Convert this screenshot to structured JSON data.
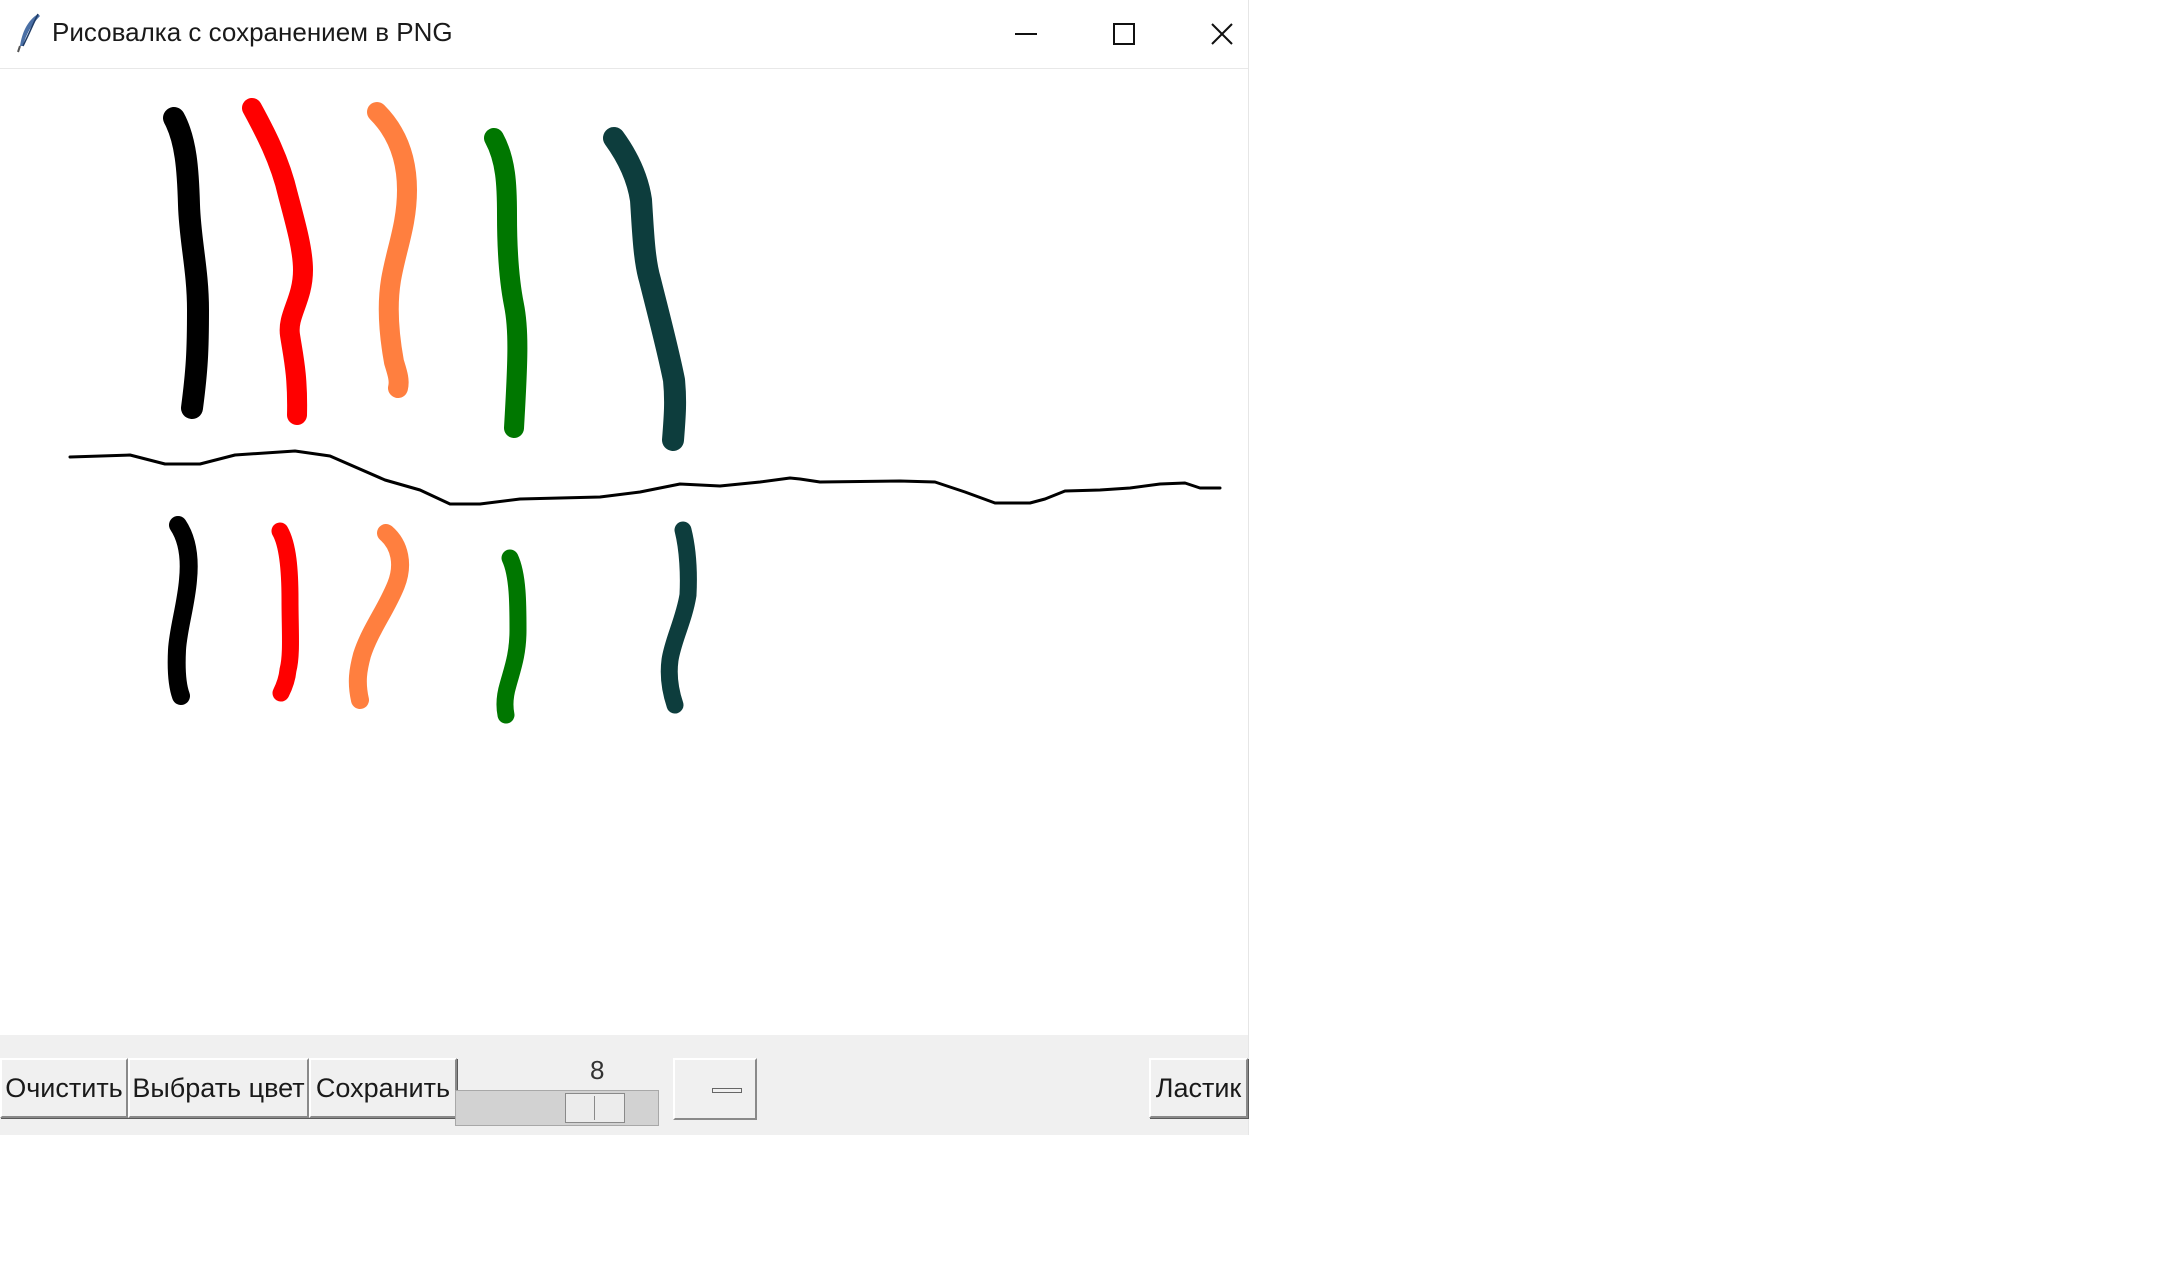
{
  "window": {
    "title": "Рисовалка с сохранением в PNG",
    "icon": "feather-icon",
    "controls": [
      "minimize-icon",
      "maximize-icon",
      "close-icon"
    ]
  },
  "canvas": {
    "background": "#ffffff",
    "stroke_colors": [
      "#000000",
      "#ff0000",
      "#ff7f3f",
      "#007700",
      "#0d3d3d"
    ]
  },
  "toolbar": {
    "clear_label": "Очистить",
    "choose_color_label": "Выбрать цвет",
    "save_label": "Сохранить",
    "brush_size_value": "8",
    "brush_size": 8,
    "brush_size_range": [
      1,
      10
    ],
    "eraser_label": "Ластик"
  }
}
